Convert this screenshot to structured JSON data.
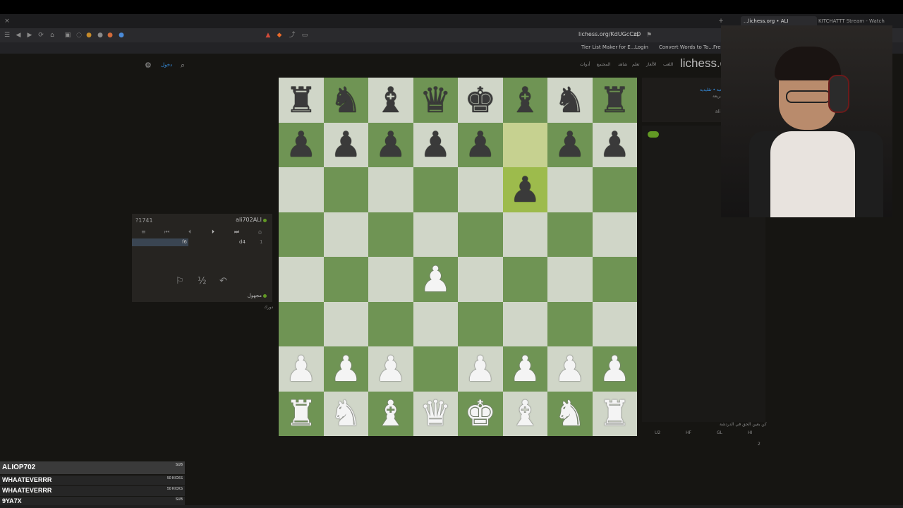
{
  "browser": {
    "tabs": [
      {
        "label": "...lichess.org • ALI",
        "active": true
      },
      {
        "label": "KITCHATTT Stream - Watch Live on K",
        "active": false
      }
    ],
    "url": "lichess.org/KdUGcCzD",
    "bookmarks": [
      "Tier List Maker for E...",
      "Login",
      "Convert Words to To...",
      "Free"
    ]
  },
  "site": {
    "logo": "lichess.o",
    "nav": [
      "اللعب",
      "الألغاز",
      "تعلم",
      "شاهد",
      "المجتمع",
      "أدوات"
    ],
    "signin": "دخول"
  },
  "board": {
    "orientation": "white",
    "ranks": [
      [
        "bR",
        "bN",
        "bB",
        "bQ",
        "bK",
        "bB",
        "bN",
        "bR"
      ],
      [
        "bP",
        "bP",
        "bP",
        "bP",
        "bP",
        "",
        "bP",
        "bP"
      ],
      [
        "",
        "",
        "",
        "",
        "",
        "bP",
        "",
        ""
      ],
      [
        "",
        "",
        "",
        "",
        "",
        "",
        "",
        ""
      ],
      [
        "",
        "",
        "",
        "wP",
        "",
        "",
        "",
        ""
      ],
      [
        "",
        "",
        "",
        "",
        "",
        "",
        "",
        ""
      ],
      [
        "wP",
        "wP",
        "wP",
        "",
        "wP",
        "wP",
        "wP",
        "wP"
      ],
      [
        "wR",
        "wN",
        "wB",
        "wQ",
        "wK",
        "wB",
        "wN",
        "wR"
      ]
    ],
    "last_move": [
      "f7",
      "f6"
    ]
  },
  "game_panel": {
    "opponent_rating": "?1741",
    "opponent_name": "ali702ALI",
    "moves": [
      {
        "num": "1",
        "white": "d4",
        "black": "f6"
      }
    ],
    "player_name": "مجهول",
    "below_label": "دورك"
  },
  "right_panel": {
    "line1": "لعبة • تقليدية",
    "line2": "سريعة",
    "line3": "ali",
    "footer": "كن بعين الحق في الدردشة",
    "cols": [
      "U2",
      "HF",
      "GL",
      "HI"
    ],
    "spectators": "2"
  },
  "chat": [
    {
      "name": "ALIOP702",
      "badge": "SUB"
    },
    {
      "name": "WHAATEVERRR",
      "badge": "50 KICKS"
    },
    {
      "name": "WHAATEVERRR",
      "badge": "50 KICKS"
    },
    {
      "name": "9YA7X",
      "badge": "SUB"
    }
  ],
  "colors": {
    "board_light": "#d0d6c8",
    "board_dark": "#6f9454",
    "accent": "#629924",
    "link": "#3692e7"
  }
}
